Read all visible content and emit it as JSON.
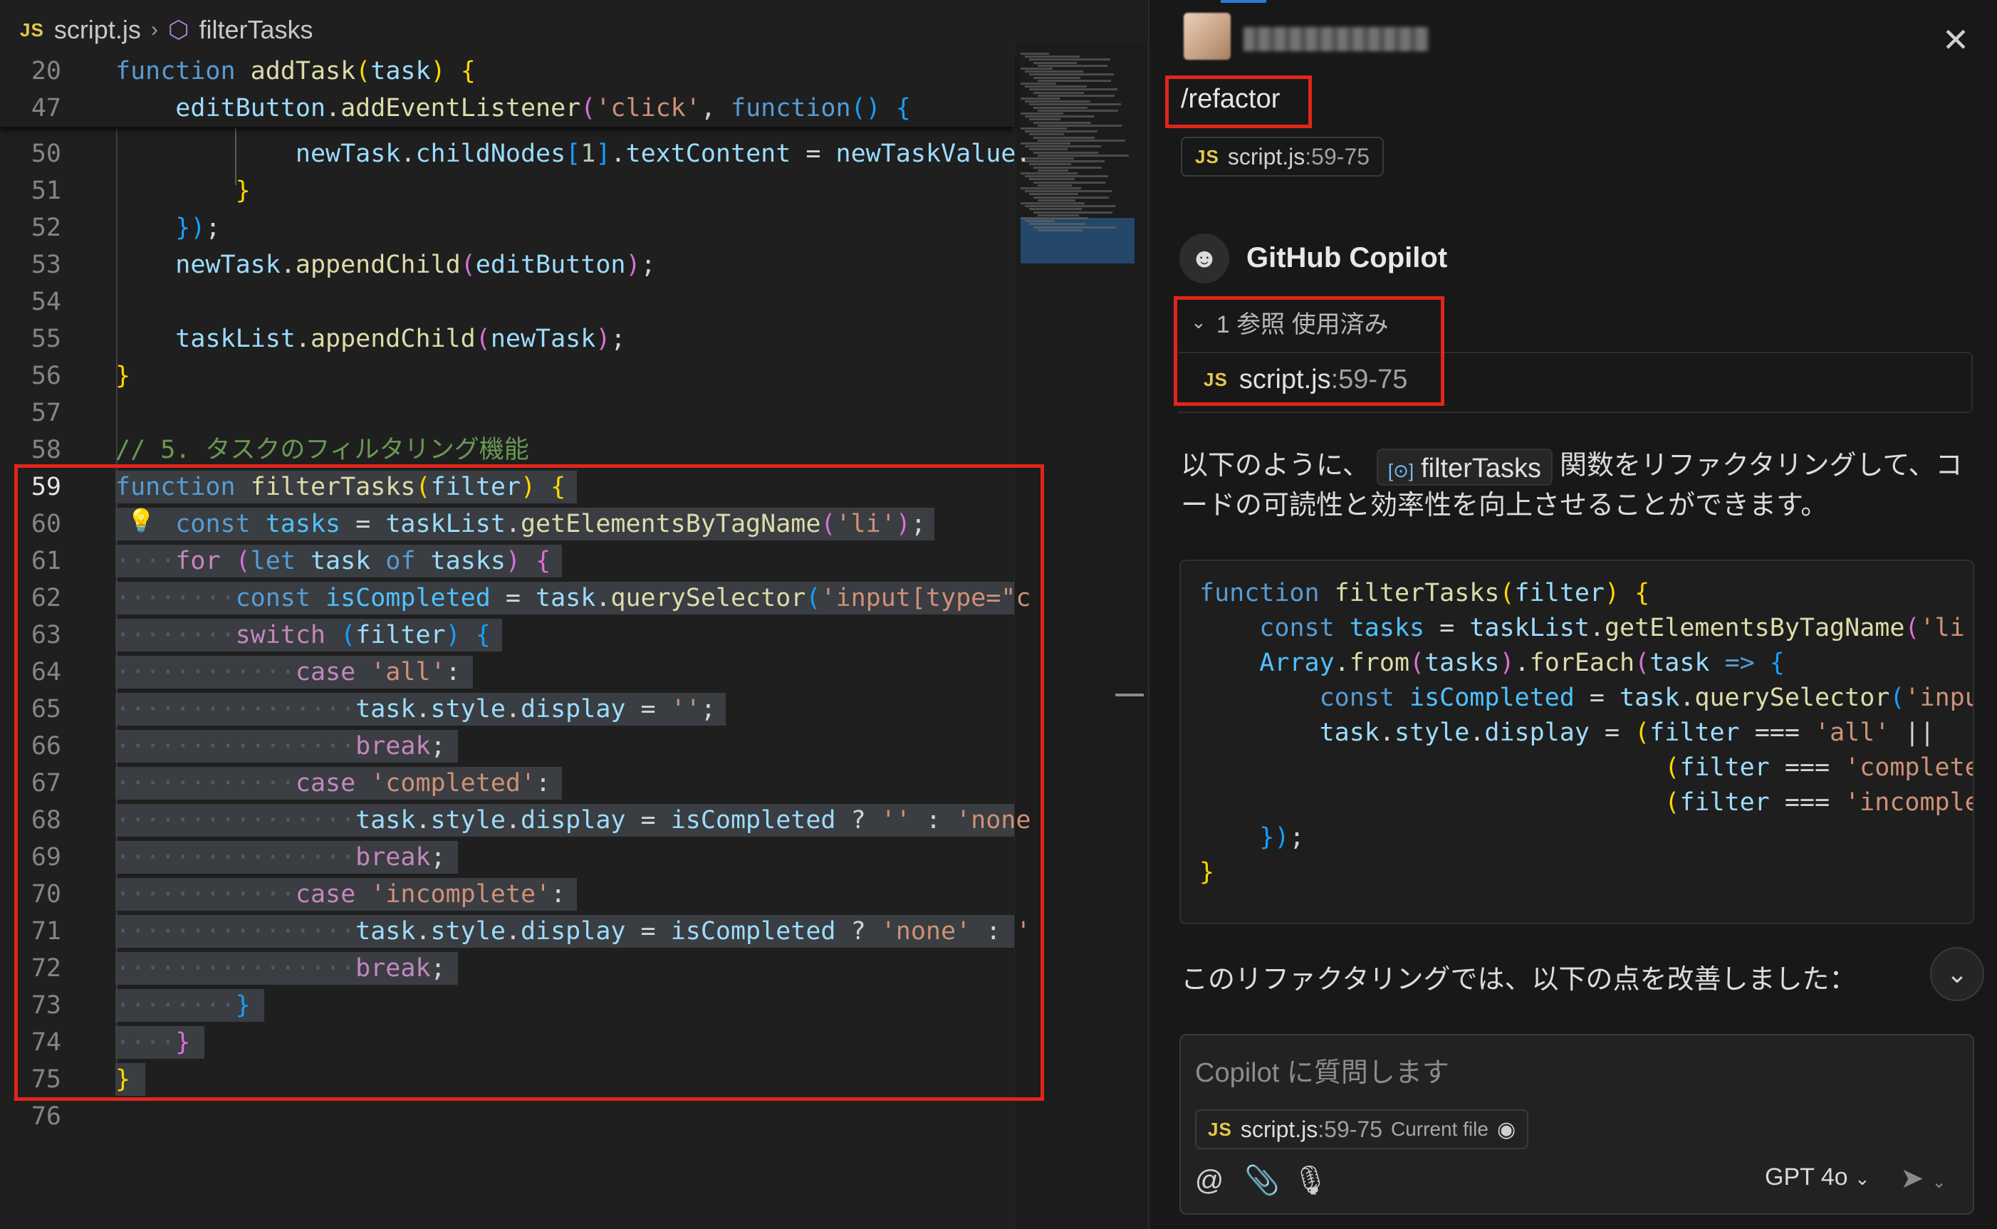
{
  "editor": {
    "breadcrumb": {
      "file": "script.js",
      "symbol": "filterTasks",
      "lang_badge": "JS"
    },
    "sticky_lines": [
      {
        "num": "20",
        "parts": [
          [
            "kw",
            "function "
          ],
          [
            "fn",
            "addTask"
          ],
          [
            "py",
            "("
          ],
          [
            "vr",
            "task"
          ],
          [
            "py",
            ") {"
          ]
        ]
      },
      {
        "num": "47",
        "parts": [
          [
            "",
            "    "
          ],
          [
            "vr",
            "editButton"
          ],
          [
            "",
            "."
          ],
          [
            "fn",
            "addEventListener"
          ],
          [
            "pp",
            "("
          ],
          [
            "st",
            "'click'"
          ],
          [
            "",
            ", "
          ],
          [
            "kw",
            "function"
          ],
          [
            "pb",
            "() {"
          ]
        ]
      }
    ],
    "lines": [
      {
        "num": "50",
        "parts": [
          [
            "",
            "            "
          ],
          [
            "vr",
            "newTask"
          ],
          [
            "",
            "."
          ],
          [
            "vr",
            "childNodes"
          ],
          [
            "pb",
            "["
          ],
          [
            "nm",
            "1"
          ],
          [
            "pb",
            "]"
          ],
          [
            "",
            "."
          ],
          [
            "vr",
            "textContent"
          ],
          [
            "",
            " = "
          ],
          [
            "vr",
            "newTaskValue"
          ],
          [
            "",
            "."
          ]
        ]
      },
      {
        "num": "51",
        "parts": [
          [
            "",
            "        "
          ],
          [
            "py",
            "}"
          ]
        ]
      },
      {
        "num": "52",
        "parts": [
          [
            "",
            "    "
          ],
          [
            "pb",
            "})"
          ],
          [
            "",
            ";"
          ]
        ]
      },
      {
        "num": "53",
        "parts": [
          [
            "",
            "    "
          ],
          [
            "vr",
            "newTask"
          ],
          [
            "",
            "."
          ],
          [
            "fn",
            "appendChild"
          ],
          [
            "pp",
            "("
          ],
          [
            "vr",
            "editButton"
          ],
          [
            "pp",
            ")"
          ],
          [
            "",
            ";"
          ]
        ]
      },
      {
        "num": "54",
        "parts": []
      },
      {
        "num": "55",
        "parts": [
          [
            "",
            "    "
          ],
          [
            "vr",
            "taskList"
          ],
          [
            "",
            "."
          ],
          [
            "fn",
            "appendChild"
          ],
          [
            "pp",
            "("
          ],
          [
            "vr",
            "newTask"
          ],
          [
            "pp",
            ")"
          ],
          [
            "",
            ";"
          ]
        ]
      },
      {
        "num": "56",
        "parts": [
          [
            "py",
            "}"
          ]
        ]
      },
      {
        "num": "57",
        "parts": []
      },
      {
        "num": "58",
        "parts": [
          [
            "cm",
            "// 5. タスクのフィルタリング機能"
          ]
        ]
      },
      {
        "num": "59",
        "current": true,
        "parts": [
          [
            "kw",
            "function "
          ],
          [
            "fn",
            "filterTasks"
          ],
          [
            "py",
            "("
          ],
          [
            "vr",
            "filter"
          ],
          [
            "py",
            ") {"
          ]
        ]
      },
      {
        "num": "60",
        "parts": [
          [
            "",
            "    "
          ],
          [
            "kw",
            "const "
          ],
          [
            "obj",
            "tasks"
          ],
          [
            "",
            " = "
          ],
          [
            "vr",
            "taskList"
          ],
          [
            "",
            "."
          ],
          [
            "fn",
            "getElementsByTagName"
          ],
          [
            "pp",
            "("
          ],
          [
            "st",
            "'li'"
          ],
          [
            "pp",
            ")"
          ],
          [
            "",
            ";"
          ]
        ]
      },
      {
        "num": "61",
        "parts": [
          [
            "dot",
            "····"
          ],
          [
            "ctl",
            "for "
          ],
          [
            "pp",
            "("
          ],
          [
            "kw",
            "let "
          ],
          [
            "vr",
            "task "
          ],
          [
            "kw",
            "of "
          ],
          [
            "vr",
            "tasks"
          ],
          [
            "pp",
            ") {"
          ]
        ]
      },
      {
        "num": "62",
        "parts": [
          [
            "dot",
            "········"
          ],
          [
            "kw",
            "const "
          ],
          [
            "obj",
            "isCompleted"
          ],
          [
            "",
            " = "
          ],
          [
            "vr",
            "task"
          ],
          [
            "",
            "."
          ],
          [
            "fn",
            "querySelector"
          ],
          [
            "pb",
            "("
          ],
          [
            "st",
            "'input[type=\"c"
          ]
        ]
      },
      {
        "num": "63",
        "parts": [
          [
            "dot",
            "········"
          ],
          [
            "ctl",
            "switch "
          ],
          [
            "pb",
            "("
          ],
          [
            "vr",
            "filter"
          ],
          [
            "pb",
            ") {"
          ]
        ]
      },
      {
        "num": "64",
        "parts": [
          [
            "dot",
            "············"
          ],
          [
            "ctl",
            "case "
          ],
          [
            "st",
            "'all'"
          ],
          [
            "",
            ":"
          ]
        ]
      },
      {
        "num": "65",
        "parts": [
          [
            "dot",
            "················"
          ],
          [
            "vr",
            "task"
          ],
          [
            "",
            "."
          ],
          [
            "prop",
            "style"
          ],
          [
            "",
            "."
          ],
          [
            "vr",
            "display"
          ],
          [
            "",
            " = "
          ],
          [
            "st",
            "''"
          ],
          [
            "",
            ";"
          ]
        ]
      },
      {
        "num": "66",
        "parts": [
          [
            "dot",
            "················"
          ],
          [
            "ctl",
            "break"
          ],
          [
            "",
            ";"
          ]
        ]
      },
      {
        "num": "67",
        "parts": [
          [
            "dot",
            "············"
          ],
          [
            "ctl",
            "case "
          ],
          [
            "st",
            "'completed'"
          ],
          [
            "",
            ":"
          ]
        ]
      },
      {
        "num": "68",
        "parts": [
          [
            "dot",
            "················"
          ],
          [
            "vr",
            "task"
          ],
          [
            "",
            "."
          ],
          [
            "prop",
            "style"
          ],
          [
            "",
            "."
          ],
          [
            "vr",
            "display"
          ],
          [
            "",
            " = "
          ],
          [
            "vr",
            "isCompleted"
          ],
          [
            "",
            " ? "
          ],
          [
            "st",
            "''"
          ],
          [
            "",
            " : "
          ],
          [
            "st",
            "'none"
          ]
        ]
      },
      {
        "num": "69",
        "parts": [
          [
            "dot",
            "················"
          ],
          [
            "ctl",
            "break"
          ],
          [
            "",
            ";"
          ]
        ]
      },
      {
        "num": "70",
        "parts": [
          [
            "dot",
            "············"
          ],
          [
            "ctl",
            "case "
          ],
          [
            "st",
            "'incomplete'"
          ],
          [
            "",
            ":"
          ]
        ]
      },
      {
        "num": "71",
        "parts": [
          [
            "dot",
            "················"
          ],
          [
            "vr",
            "task"
          ],
          [
            "",
            "."
          ],
          [
            "prop",
            "style"
          ],
          [
            "",
            "."
          ],
          [
            "vr",
            "display"
          ],
          [
            "",
            " = "
          ],
          [
            "vr",
            "isCompleted"
          ],
          [
            "",
            " ? "
          ],
          [
            "st",
            "'none'"
          ],
          [
            "",
            " : "
          ],
          [
            "st",
            "'"
          ]
        ]
      },
      {
        "num": "72",
        "parts": [
          [
            "dot",
            "················"
          ],
          [
            "ctl",
            "break"
          ],
          [
            "",
            ";"
          ]
        ]
      },
      {
        "num": "73",
        "parts": [
          [
            "dot",
            "········"
          ],
          [
            "pb",
            "}"
          ]
        ]
      },
      {
        "num": "74",
        "parts": [
          [
            "dot",
            "····"
          ],
          [
            "pp",
            "}"
          ]
        ]
      },
      {
        "num": "75",
        "parts": [
          [
            "py",
            "}"
          ]
        ]
      },
      {
        "num": "76",
        "parts": []
      }
    ]
  },
  "chat": {
    "slash_command": "/refactor",
    "context_chip": {
      "file": "script.js",
      "range": ":59-75"
    },
    "assistant_name": "GitHub Copilot",
    "references": {
      "header": "1 参照 使用済み",
      "file": "script.js",
      "range": ":59-75"
    },
    "intro_before": "以下のように、",
    "intro_symbol": "filterTasks",
    "intro_after": "関数をリファクタリングして、コードの可読性と効率性を向上させることができます。",
    "code_lines": [
      [
        [
          "kw",
          "function "
        ],
        [
          "fn",
          "filterTasks"
        ],
        [
          "py",
          "("
        ],
        [
          "vr",
          "filter"
        ],
        [
          "py",
          ") {"
        ]
      ],
      [
        [
          "",
          "    "
        ],
        [
          "kw",
          "const "
        ],
        [
          "obj",
          "tasks"
        ],
        [
          "",
          " = "
        ],
        [
          "vr",
          "taskList"
        ],
        [
          "",
          "."
        ],
        [
          "fn",
          "getElementsByTagName"
        ],
        [
          "pp",
          "("
        ],
        [
          "st",
          "'li"
        ]
      ],
      [
        [
          "",
          "    "
        ],
        [
          "obj",
          "Array"
        ],
        [
          "",
          "."
        ],
        [
          "fn",
          "from"
        ],
        [
          "pp",
          "("
        ],
        [
          "vr",
          "tasks"
        ],
        [
          "pp",
          ")"
        ],
        [
          "",
          "."
        ],
        [
          "fn",
          "forEach"
        ],
        [
          "pp",
          "("
        ],
        [
          "vr",
          "task "
        ],
        [
          "kw",
          "=>"
        ],
        [
          "pb",
          " {"
        ]
      ],
      [
        [
          "",
          "        "
        ],
        [
          "kw",
          "const "
        ],
        [
          "obj",
          "isCompleted"
        ],
        [
          "",
          " = "
        ],
        [
          "vr",
          "task"
        ],
        [
          "",
          "."
        ],
        [
          "fn",
          "querySelector"
        ],
        [
          "pb",
          "("
        ],
        [
          "st",
          "'inpu"
        ]
      ],
      [
        [
          "",
          "        "
        ],
        [
          "vr",
          "task"
        ],
        [
          "",
          "."
        ],
        [
          "vr",
          "style"
        ],
        [
          "",
          "."
        ],
        [
          "vr",
          "display"
        ],
        [
          "",
          " = "
        ],
        [
          "py",
          "("
        ],
        [
          "vr",
          "filter"
        ],
        [
          "",
          " === "
        ],
        [
          "st",
          "'all'"
        ],
        [
          "",
          " ||"
        ]
      ],
      [
        [
          "",
          "                               "
        ],
        [
          "py",
          "("
        ],
        [
          "vr",
          "filter"
        ],
        [
          "",
          " === "
        ],
        [
          "st",
          "'completed"
        ]
      ],
      [
        [
          "",
          "                               "
        ],
        [
          "py",
          "("
        ],
        [
          "vr",
          "filter"
        ],
        [
          "",
          " === "
        ],
        [
          "st",
          "'incomplete"
        ]
      ],
      [
        [
          "",
          "    "
        ],
        [
          "pb",
          "})"
        ],
        [
          "",
          ";"
        ]
      ],
      [
        [
          "py",
          "}"
        ]
      ]
    ],
    "followup": "このリファクタリングでは、以下の点を改善しました：",
    "input": {
      "placeholder": "Copilot に質問します",
      "chip_file": "script.js",
      "chip_range": ":59-75",
      "chip_label": "Current file",
      "model": "GPT 4o"
    }
  }
}
